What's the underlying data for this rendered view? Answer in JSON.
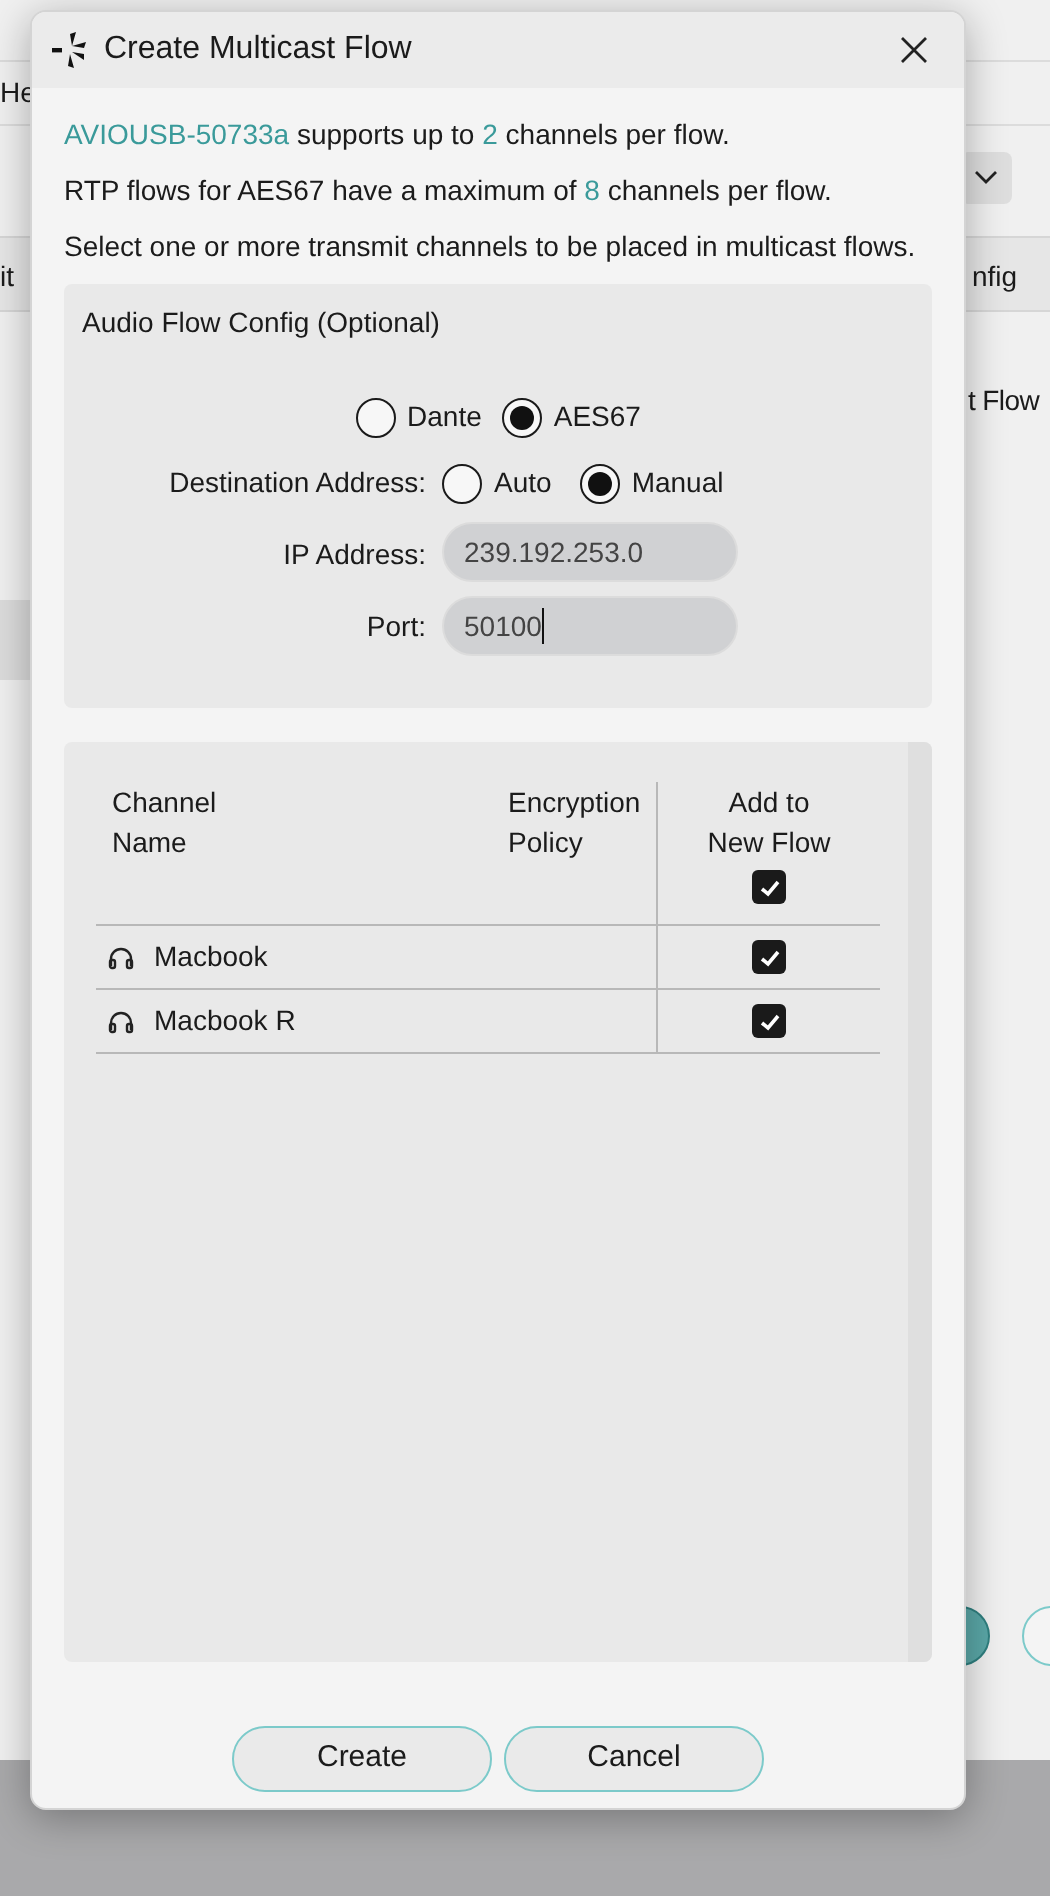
{
  "background": {
    "menu_fragment": "He",
    "tab_fragment": "it",
    "tab_fragment_right": "nfig",
    "heading_fragment": "t Flow"
  },
  "dialog": {
    "title": "Create Multicast Flow",
    "info_lines": [
      [
        {
          "text": "AVIOUSB-50733a",
          "highlight": true
        },
        {
          "text": " supports up to ",
          "highlight": false
        },
        {
          "text": "2",
          "highlight": true
        },
        {
          "text": " channels per flow.",
          "highlight": false
        }
      ],
      [
        {
          "text": "RTP flows for AES67 have a maximum of ",
          "highlight": false
        },
        {
          "text": "8",
          "highlight": true
        },
        {
          "text": " channels per flow.",
          "highlight": false
        }
      ],
      [
        {
          "text": "Select one or more transmit channels to be placed in multicast flows.",
          "highlight": false
        }
      ]
    ],
    "config": {
      "title": "Audio Flow Config (Optional)",
      "flow_types": [
        {
          "label": "Dante",
          "selected": false
        },
        {
          "label": "AES67",
          "selected": true
        }
      ],
      "destination_label": "Destination Address:",
      "destination_modes": [
        {
          "label": "Auto",
          "selected": false
        },
        {
          "label": "Manual",
          "selected": true
        }
      ],
      "ip_label": "IP Address:",
      "ip_value": "239.192.253.0",
      "port_label": "Port:",
      "port_value": "50100"
    },
    "table": {
      "columns": [
        "Channel Name",
        "Encryption Policy",
        "Add to New Flow"
      ],
      "all_checked": true,
      "rows": [
        {
          "name": "Macbook",
          "checked": true
        },
        {
          "name": "Macbook R",
          "checked": true
        }
      ]
    },
    "buttons": [
      "Create",
      "Cancel"
    ]
  }
}
